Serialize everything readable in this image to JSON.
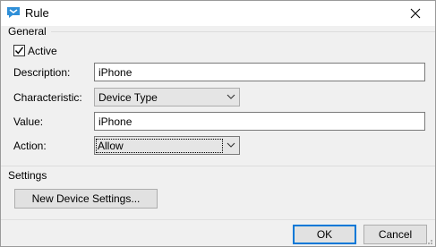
{
  "window": {
    "title": "Rule",
    "icon": "rule-app-icon",
    "close_icon": "close-icon"
  },
  "general": {
    "group_label": "General",
    "active": {
      "label": "Active",
      "checked": true
    },
    "description": {
      "label": "Description:",
      "value": "iPhone"
    },
    "characteristic": {
      "label": "Characteristic:",
      "value": "Device Type"
    },
    "value": {
      "label": "Value:",
      "value": "iPhone"
    },
    "action": {
      "label": "Action:",
      "value": "Allow"
    }
  },
  "settings": {
    "group_label": "Settings",
    "new_device_button": "New Device Settings..."
  },
  "footer": {
    "ok_label": "OK",
    "cancel_label": "Cancel"
  },
  "colors": {
    "accent": "#0078d7",
    "icon_blue": "#2f8fd8"
  }
}
